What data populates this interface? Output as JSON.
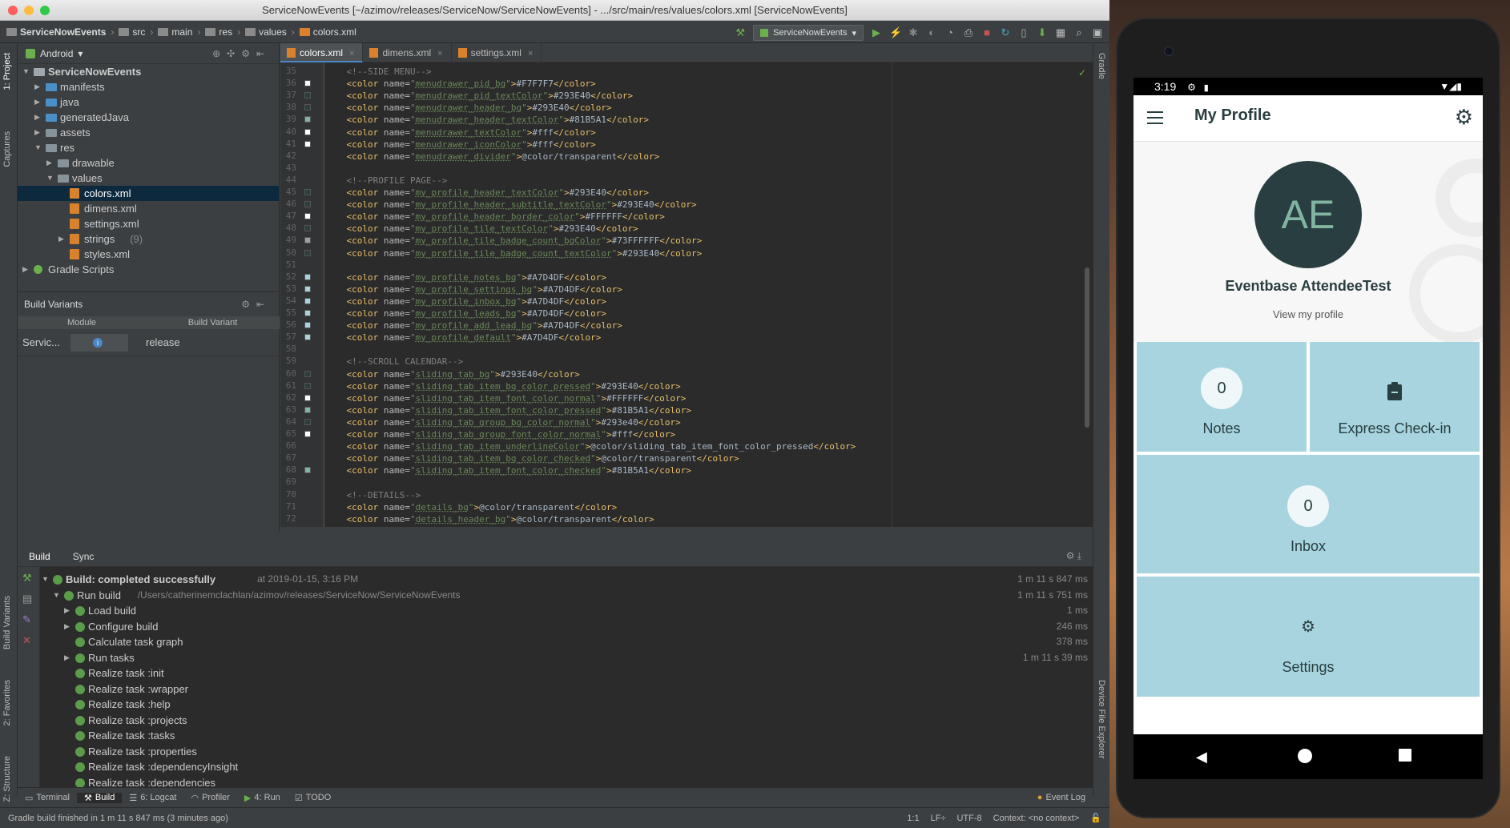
{
  "ide": {
    "window_title": "ServiceNowEvents [~/azimov/releases/ServiceNow/ServiceNowEvents] - .../src/main/res/values/colors.xml [ServiceNowEvents]",
    "breadcrumbs": [
      "ServiceNowEvents",
      "src",
      "main",
      "res",
      "values",
      "colors.xml"
    ],
    "run_config": "ServiceNowEvents",
    "project_panel": {
      "view_mode": "Android",
      "tree": [
        {
          "label": "ServiceNowEvents",
          "depth": 0,
          "kind": "module",
          "expanded": true
        },
        {
          "label": "manifests",
          "depth": 1,
          "kind": "folder"
        },
        {
          "label": "java",
          "depth": 1,
          "kind": "folder"
        },
        {
          "label": "generatedJava",
          "depth": 1,
          "kind": "folder"
        },
        {
          "label": "assets",
          "depth": 1,
          "kind": "folder"
        },
        {
          "label": "res",
          "depth": 1,
          "kind": "folder",
          "expanded": true
        },
        {
          "label": "drawable",
          "depth": 2,
          "kind": "folder"
        },
        {
          "label": "values",
          "depth": 2,
          "kind": "folder",
          "expanded": true
        },
        {
          "label": "colors.xml",
          "depth": 3,
          "kind": "xml",
          "selected": true
        },
        {
          "label": "dimens.xml",
          "depth": 3,
          "kind": "xml"
        },
        {
          "label": "settings.xml",
          "depth": 3,
          "kind": "xml"
        },
        {
          "label": "strings",
          "depth": 3,
          "kind": "xmlgroup",
          "count": "(9)"
        },
        {
          "label": "styles.xml",
          "depth": 3,
          "kind": "xml"
        },
        {
          "label": "Gradle Scripts",
          "depth": 0,
          "kind": "gradle"
        }
      ]
    },
    "build_variants": {
      "title": "Build Variants",
      "col_module": "Module",
      "col_variant": "Build Variant",
      "row_module": "Servic...",
      "row_variant": "release"
    },
    "editor_tabs": [
      "colors.xml",
      "dimens.xml",
      "settings.xml"
    ],
    "code_lines": [
      {
        "n": "35",
        "c": "comment",
        "text": "    <!--SIDE MENU-->"
      },
      {
        "n": "36",
        "sw": "#F7F7F7",
        "name": "menudrawer_pid_bg",
        "value": "#F7F7F7"
      },
      {
        "n": "37",
        "sw": "#293E40",
        "name": "menudrawer_pid_textColor",
        "value": "#293E40"
      },
      {
        "n": "38",
        "sw": "#293E40",
        "name": "menudrawer_header_bg",
        "value": "#293E40"
      },
      {
        "n": "39",
        "sw": "#81B5A1",
        "name": "menudrawer_header_textColor",
        "value": "#81B5A1"
      },
      {
        "n": "40",
        "sw": "#ffffff",
        "name": "menudrawer_textColor",
        "value": "#fff"
      },
      {
        "n": "41",
        "sw": "#ffffff",
        "name": "menudrawer_iconColor",
        "value": "#fff"
      },
      {
        "n": "42",
        "name": "menudrawer_divider",
        "value": "@color/transparent"
      },
      {
        "n": "43",
        "c": "blank",
        "text": ""
      },
      {
        "n": "44",
        "c": "comment",
        "text": "    <!--PROFILE PAGE-->"
      },
      {
        "n": "45",
        "sw": "#293E40",
        "name": "my_profile_header_textColor",
        "value": "#293E40"
      },
      {
        "n": "46",
        "sw": "#293E40",
        "name": "my_profile_header_subtitle_textColor",
        "value": "#293E40"
      },
      {
        "n": "47",
        "sw": "#FFFFFF",
        "name": "my_profile_header_border_color",
        "value": "#FFFFFF"
      },
      {
        "n": "48",
        "sw": "#293E40",
        "name": "my_profile_tile_textColor",
        "value": "#293E40"
      },
      {
        "n": "49",
        "sw": "#a0a0a0",
        "name": "my_profile_tile_badge_count_bgColor",
        "value": "#73FFFFFF"
      },
      {
        "n": "50",
        "sw": "#293E40",
        "name": "my_profile_tile_badge_count_textColor",
        "value": "#293E40"
      },
      {
        "n": "51",
        "c": "blank",
        "text": ""
      },
      {
        "n": "52",
        "sw": "#A7D4DF",
        "name": "my_profile_notes_bg",
        "value": "#A7D4DF"
      },
      {
        "n": "53",
        "sw": "#A7D4DF",
        "name": "my_profile_settings_bg",
        "value": "#A7D4DF"
      },
      {
        "n": "54",
        "sw": "#A7D4DF",
        "name": "my_profile_inbox_bg",
        "value": "#A7D4DF"
      },
      {
        "n": "55",
        "sw": "#A7D4DF",
        "name": "my_profile_leads_bg",
        "value": "#A7D4DF"
      },
      {
        "n": "56",
        "sw": "#A7D4DF",
        "name": "my_profile_add_lead_bg",
        "value": "#A7D4DF"
      },
      {
        "n": "57",
        "sw": "#A7D4DF",
        "name": "my_profile_default",
        "value": "#A7D4DF"
      },
      {
        "n": "58",
        "c": "blank",
        "text": ""
      },
      {
        "n": "59",
        "c": "comment",
        "text": "    <!--SCROLL CALENDAR-->"
      },
      {
        "n": "60",
        "sw": "#293E40",
        "name": "sliding_tab_bg",
        "value": "#293E40"
      },
      {
        "n": "61",
        "sw": "#293E40",
        "name": "sliding_tab_item_bg_color_pressed",
        "value": "#293E40"
      },
      {
        "n": "62",
        "sw": "#FFFFFF",
        "name": "sliding_tab_item_font_color_normal",
        "value": "#FFFFFF"
      },
      {
        "n": "63",
        "sw": "#81B5A1",
        "name": "sliding_tab_item_font_color_pressed",
        "value": "#81B5A1"
      },
      {
        "n": "64",
        "sw": "#293e40",
        "name": "sliding_tab_group_bg_color_normal",
        "value": "#293e40"
      },
      {
        "n": "65",
        "sw": "#ffffff",
        "name": "sliding_tab_group_font_color_normal",
        "value": "#fff"
      },
      {
        "n": "66",
        "name": "sliding_tab_item_underlineColor",
        "value": "@color/sliding_tab_item_font_color_pressed"
      },
      {
        "n": "67",
        "name": "sliding_tab_item_bg_color_checked",
        "value": "@color/transparent"
      },
      {
        "n": "68",
        "sw": "#81B5A1",
        "name": "sliding_tab_item_font_color_checked",
        "value": "#81B5A1"
      },
      {
        "n": "69",
        "c": "blank",
        "text": ""
      },
      {
        "n": "70",
        "c": "comment",
        "text": "    <!--DETAILS-->"
      },
      {
        "n": "71",
        "name": "details_bg",
        "value": "@color/transparent"
      },
      {
        "n": "72",
        "name": "details_header_bg",
        "value": "@color/transparent"
      }
    ],
    "build_panel": {
      "tabs": [
        "Build",
        "Sync"
      ],
      "rows": [
        {
          "label": "Build: completed successfully",
          "extra": "at 2019-01-15, 3:16 PM",
          "time": "1 m 11 s 847 ms",
          "depth": 0,
          "arrow": "down",
          "bold": true
        },
        {
          "label": "Run build",
          "extra": "/Users/catherinemclachlan/azimov/releases/ServiceNow/ServiceNowEvents",
          "time": "1 m 11 s 751 ms",
          "depth": 1,
          "arrow": "down",
          "bold": false
        },
        {
          "label": "Load build",
          "extra": "",
          "time": "1 ms",
          "depth": 2,
          "arrow": "right"
        },
        {
          "label": "Configure build",
          "extra": "",
          "time": "246 ms",
          "depth": 2,
          "arrow": "right"
        },
        {
          "label": "Calculate task graph",
          "extra": "",
          "time": "378 ms",
          "depth": 2,
          "arrow": ""
        },
        {
          "label": "Run tasks",
          "extra": "",
          "time": "1 m 11 s 39 ms",
          "depth": 2,
          "arrow": "right"
        },
        {
          "label": "Realize task :init",
          "extra": "",
          "time": "",
          "depth": 2,
          "arrow": ""
        },
        {
          "label": "Realize task :wrapper",
          "extra": "",
          "time": "",
          "depth": 2,
          "arrow": ""
        },
        {
          "label": "Realize task :help",
          "extra": "",
          "time": "",
          "depth": 2,
          "arrow": ""
        },
        {
          "label": "Realize task :projects",
          "extra": "",
          "time": "",
          "depth": 2,
          "arrow": ""
        },
        {
          "label": "Realize task :tasks",
          "extra": "",
          "time": "",
          "depth": 2,
          "arrow": ""
        },
        {
          "label": "Realize task :properties",
          "extra": "",
          "time": "",
          "depth": 2,
          "arrow": ""
        },
        {
          "label": "Realize task :dependencyInsight",
          "extra": "",
          "time": "",
          "depth": 2,
          "arrow": ""
        },
        {
          "label": "Realize task :dependencies",
          "extra": "",
          "time": "",
          "depth": 2,
          "arrow": ""
        }
      ]
    },
    "bottom_tabs": [
      "Terminal",
      "Build",
      "6: Logcat",
      "Profiler",
      "4: Run",
      "TODO"
    ],
    "event_log": "Event Log",
    "status_message": "Gradle build finished in 1 m 11 s 847 ms (3 minutes ago)",
    "status_right": [
      "1:1",
      "LF÷",
      "UTF-8",
      "Context: <no context>"
    ],
    "side_tabs_left": [
      "1: Project",
      "Captures",
      "Build Variants",
      "2: Favorites",
      "Z: Structure"
    ],
    "side_tabs_right": [
      "Gradle",
      "Device File Explorer"
    ]
  },
  "phone": {
    "time": "3:19",
    "app_title": "My Profile",
    "avatar_initials": "AE",
    "profile_name": "Eventbase AttendeeTest",
    "view_profile": "View my profile",
    "tiles": [
      {
        "label": "Notes",
        "badge": "0"
      },
      {
        "label": "Express Check-in",
        "icon": "clipboard-icon"
      },
      {
        "label": "Inbox",
        "badge": "0"
      },
      {
        "label": "Settings",
        "icon": "gear-icon"
      }
    ],
    "colors": {
      "primary": "#293E40",
      "accent": "#81B5A1",
      "tile": "#A7D4DF"
    }
  }
}
